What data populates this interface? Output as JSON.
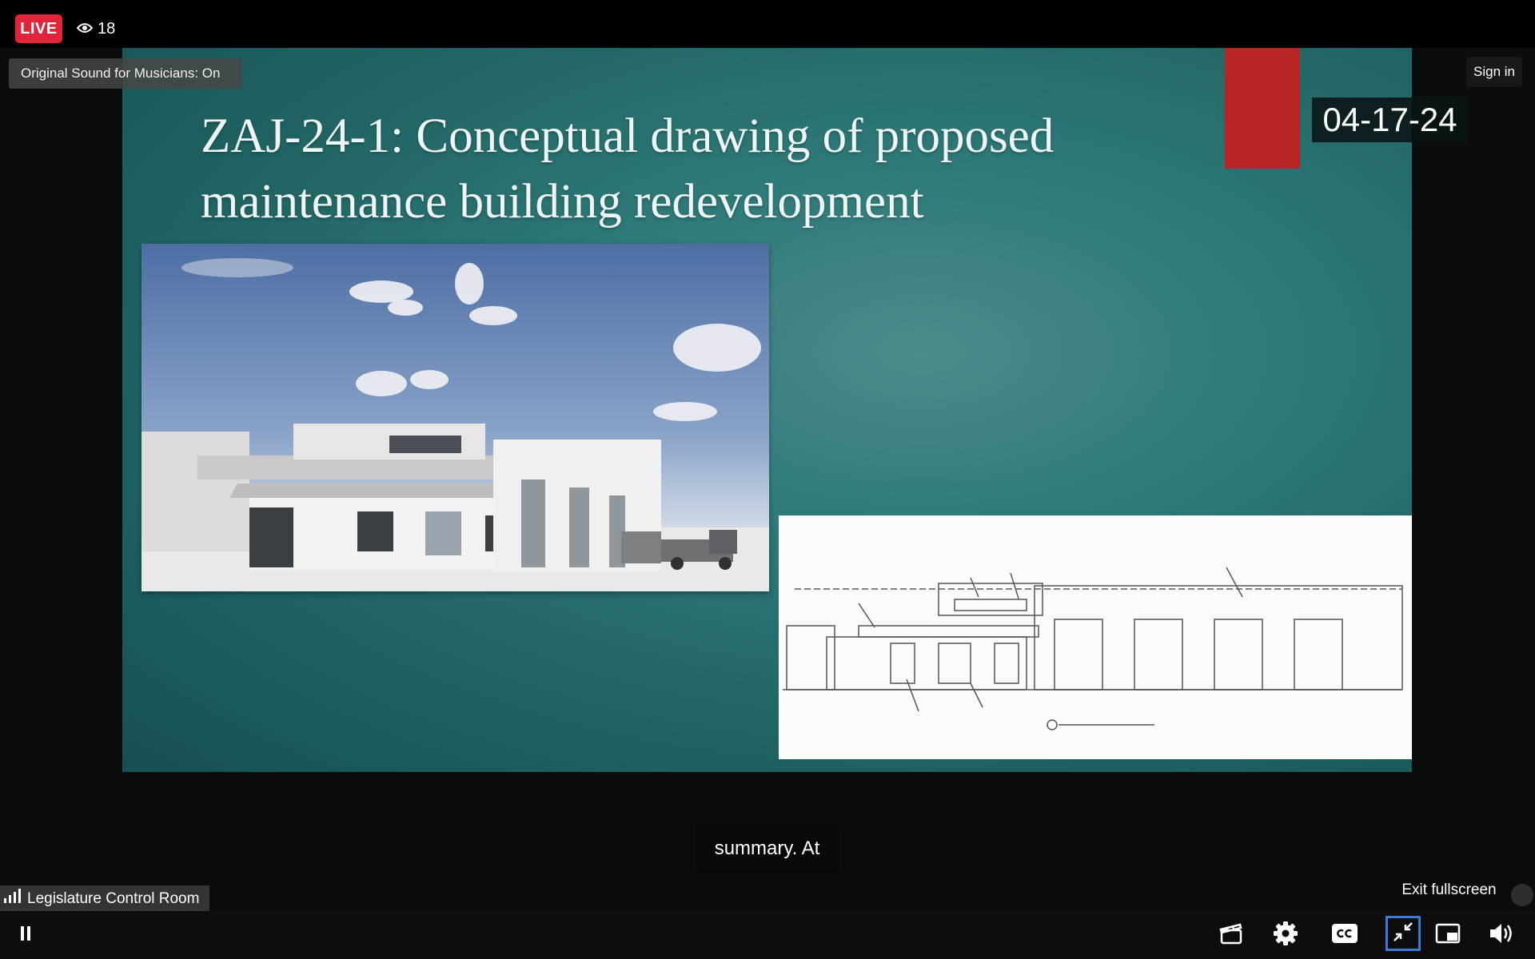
{
  "stream": {
    "live_label": "LIVE",
    "viewer_count": "18",
    "sound_setting": "Original Sound for Musicians: On",
    "sign_in_label": "Sign in",
    "source_name": "Legislature Control Room"
  },
  "slide": {
    "title_line1": "ZAJ-24-1: Conceptual drawing of proposed",
    "title_line2": "maintenance building redevelopment",
    "date_overlay": "04-17-24"
  },
  "captions": {
    "current_text": "summary. At"
  },
  "player": {
    "exit_fullscreen_tooltip": "Exit fullscreen"
  },
  "colors": {
    "live_red": "#e0243a",
    "slide_teal": "#2f7a7a",
    "focus_blue": "#3a7bd5"
  }
}
